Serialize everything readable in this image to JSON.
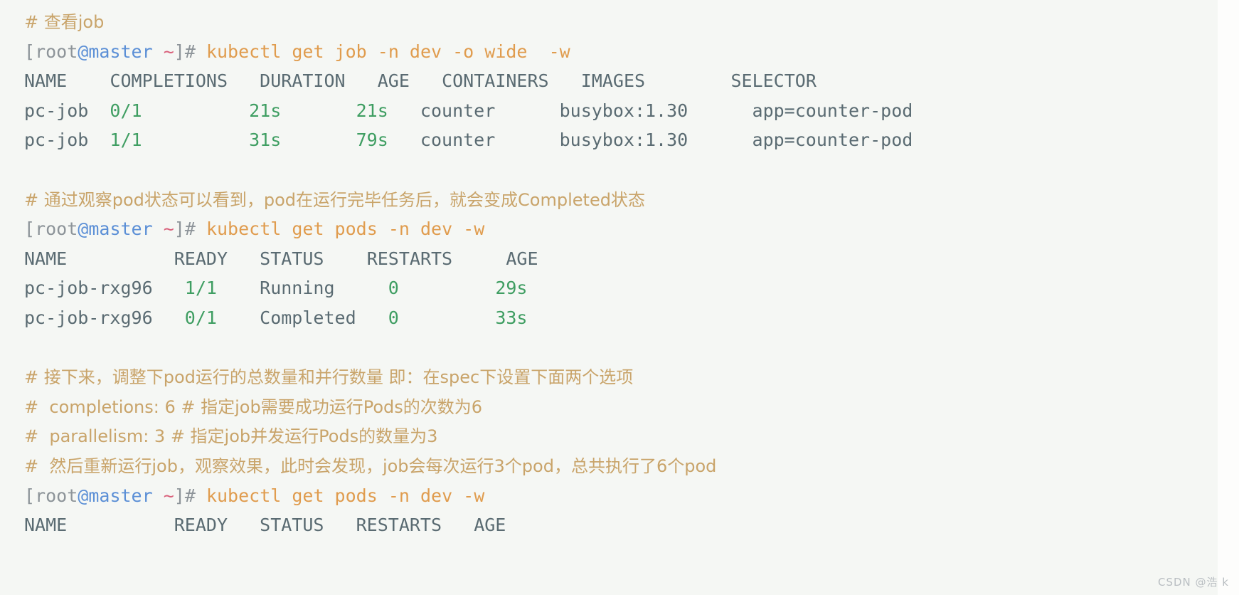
{
  "window": {
    "background_color": "#f5f7f4",
    "page_background_color": "#ffffff"
  },
  "colors": {
    "comment": "#c8964f",
    "comment_cn": "#c9a46a",
    "command": "#e09c4e",
    "prompt_user": "#8d9499",
    "prompt_host": "#5b8fd6",
    "prompt_tilde": "#d9607a",
    "table_header": "#5a6b72",
    "value_text": "#5a6b72",
    "number_green": "#3f9e62",
    "punct_red": "#d9607a",
    "watermark": "#b9bec2"
  },
  "terminal": {
    "prompt": {
      "open_bracket": "[",
      "user": "root",
      "at": "@",
      "host": "master",
      "space_tilde": " ~",
      "close_bracket": "]",
      "hash": "#"
    },
    "blocks": [
      {
        "comment": "# 查看job",
        "command": " kubectl get job -n dev -o wide  -w",
        "table": {
          "headers": [
            "NAME",
            "COMPLETIONS",
            "DURATION",
            "AGE",
            "CONTAINERS",
            "IMAGES",
            "SELECTOR"
          ],
          "rows": [
            {
              "name": "pc-job",
              "completions": "0/1",
              "duration": "21s",
              "age": "21s",
              "containers": "counter",
              "images": "busybox:1.30",
              "selector": "app=counter-pod"
            },
            {
              "name": "pc-job",
              "completions": "1/1",
              "duration": "31s",
              "age": "79s",
              "containers": "counter",
              "images": "busybox:1.30",
              "selector": "app=counter-pod"
            }
          ]
        }
      },
      {
        "comment": "# 通过观察pod状态可以看到，pod在运行完毕任务后，就会变成Completed状态",
        "command": " kubectl get pods -n dev -w",
        "table": {
          "headers": [
            "NAME",
            "READY",
            "STATUS",
            "RESTARTS",
            "AGE"
          ],
          "rows": [
            {
              "name": "pc-job-rxg96",
              "ready": "1/1",
              "status": "Running",
              "restarts": "0",
              "age": "29s"
            },
            {
              "name": "pc-job-rxg96",
              "ready": "0/1",
              "status": "Completed",
              "restarts": "0",
              "age": "33s"
            }
          ]
        }
      },
      {
        "comments": [
          "# 接下来，调整下pod运行的总数量和并行数量 即：在spec下设置下面两个选项",
          "#  completions: 6 # 指定job需要成功运行Pods的次数为6",
          "#  parallelism: 3 # 指定job并发运行Pods的数量为3",
          "#  然后重新运行job，观察效果，此时会发现，job会每次运行3个pod，总共执行了6个pod"
        ],
        "command": " kubectl get pods -n dev -w",
        "table": {
          "headers": [
            "NAME",
            "READY",
            "STATUS",
            "RESTARTS",
            "AGE"
          ],
          "rows": []
        }
      }
    ]
  },
  "watermark": {
    "text": "CSDN @浩 k"
  }
}
